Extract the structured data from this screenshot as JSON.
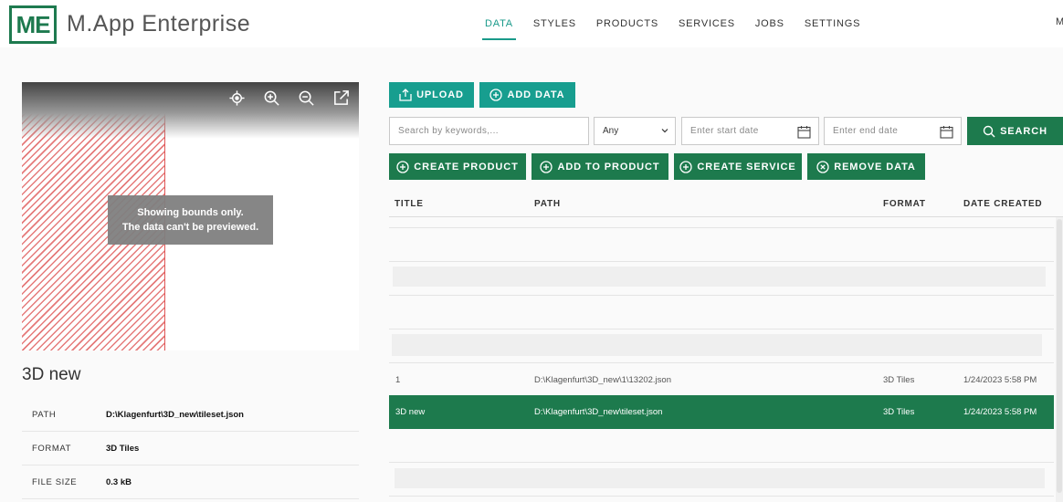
{
  "header": {
    "logo": "ME",
    "app_name": "M.App Enterprise",
    "nav": [
      "DATA",
      "STYLES",
      "PRODUCTS",
      "SERVICES",
      "JOBS",
      "SETTINGS"
    ],
    "active_nav": "DATA",
    "user_initial": "M"
  },
  "preview": {
    "message_line1": "Showing bounds only.",
    "message_line2": "The data can't be previewed.",
    "tools": [
      "locate-icon",
      "zoom-in-icon",
      "zoom-out-icon",
      "open-external-icon"
    ]
  },
  "details": {
    "title": "3D new",
    "rows": [
      {
        "key": "PATH",
        "value": "D:\\Klagenfurt\\3D_new\\tileset.json"
      },
      {
        "key": "FORMAT",
        "value": "3D Tiles"
      },
      {
        "key": "FILE SIZE",
        "value": "0.3 kB"
      }
    ]
  },
  "toolbar": {
    "upload_label": "UPLOAD",
    "add_data_label": "ADD DATA",
    "search_placeholder": "Search by keywords,...",
    "type_value": "Any",
    "start_date_placeholder": "Enter start date",
    "end_date_placeholder": "Enter end date",
    "search_label": "SEARCH",
    "create_product_label": "CREATE PRODUCT",
    "add_to_product_label": "ADD TO PRODUCT",
    "create_service_label": "CREATE SERVICE",
    "remove_data_label": "REMOVE DATA"
  },
  "table": {
    "columns": [
      "TITLE",
      "PATH",
      "FORMAT",
      "DATE CREATED"
    ],
    "rows": [
      {
        "title": "1",
        "path": "D:\\Klagenfurt\\3D_new\\1\\13202.json",
        "format": "3D Tiles",
        "date": "1/24/2023 5:58 PM",
        "selected": false
      },
      {
        "title": "3D new",
        "path": "D:\\Klagenfurt\\3D_new\\tileset.json",
        "format": "3D Tiles",
        "date": "1/24/2023 5:58 PM",
        "selected": true
      }
    ]
  },
  "colors": {
    "teal": "#179e8f",
    "green": "#1d7a4d",
    "nav_active": "#1a9a8a"
  }
}
